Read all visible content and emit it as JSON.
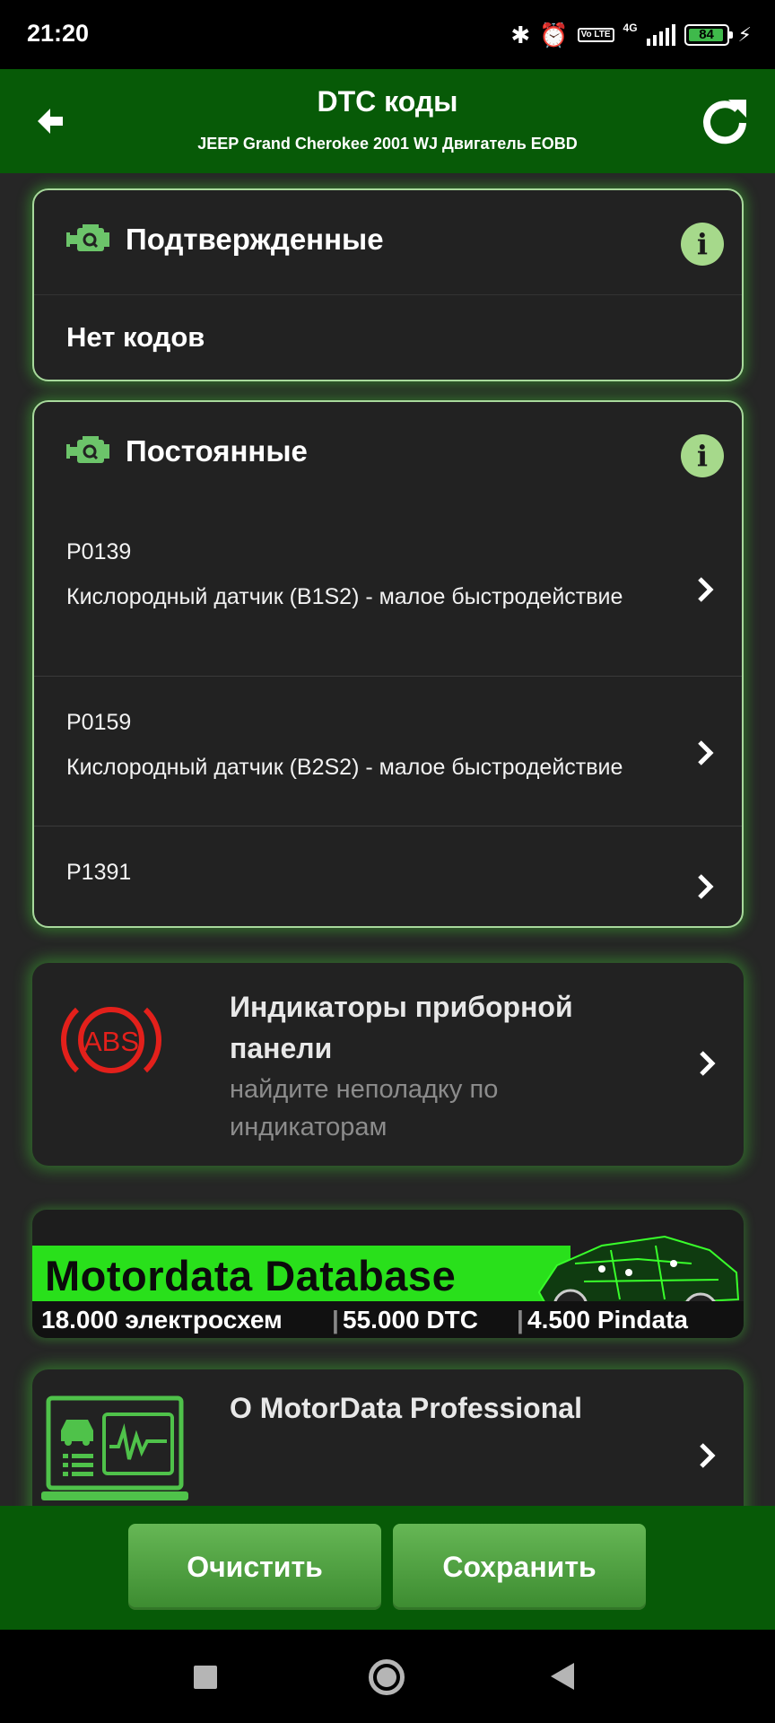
{
  "status_bar": {
    "time": "21:20",
    "network": "4G",
    "volte": "Vo LTE",
    "battery": "84"
  },
  "header": {
    "title": "DTC коды",
    "subtitle": "JEEP Grand Cherokee 2001 WJ Двигатель EOBD"
  },
  "confirmed": {
    "title": "Подтвержденные",
    "empty_text": "Нет кодов"
  },
  "permanent": {
    "title": "Постоянные",
    "items": [
      {
        "code": "P0139",
        "description": "Кислородный датчик (B1S2) - малое быстродействие"
      },
      {
        "code": "P0159",
        "description": "Кислородный датчик (B2S2) - малое быстродействие"
      },
      {
        "code": "P1391",
        "description": ""
      }
    ]
  },
  "indicators": {
    "title_line1": "Индикаторы приборной",
    "title_line2": "панели",
    "subtitle_line1": "найдите неполадку по",
    "subtitle_line2": "индикаторам",
    "icon_text": "ABS"
  },
  "banner": {
    "title": "Motordata Database",
    "stat1": "18.000 электросхем",
    "stat2": "55.000 DTC",
    "stat3": "4.500 Pindata"
  },
  "about": {
    "title": "О MotorData Professional"
  },
  "footer": {
    "clear_label": "Очистить",
    "save_label": "Сохранить"
  },
  "colors": {
    "header_green": "#075a07",
    "accent_green": "#a6d98b",
    "banner_green": "#29e01b",
    "abs_red": "#e3201b"
  }
}
